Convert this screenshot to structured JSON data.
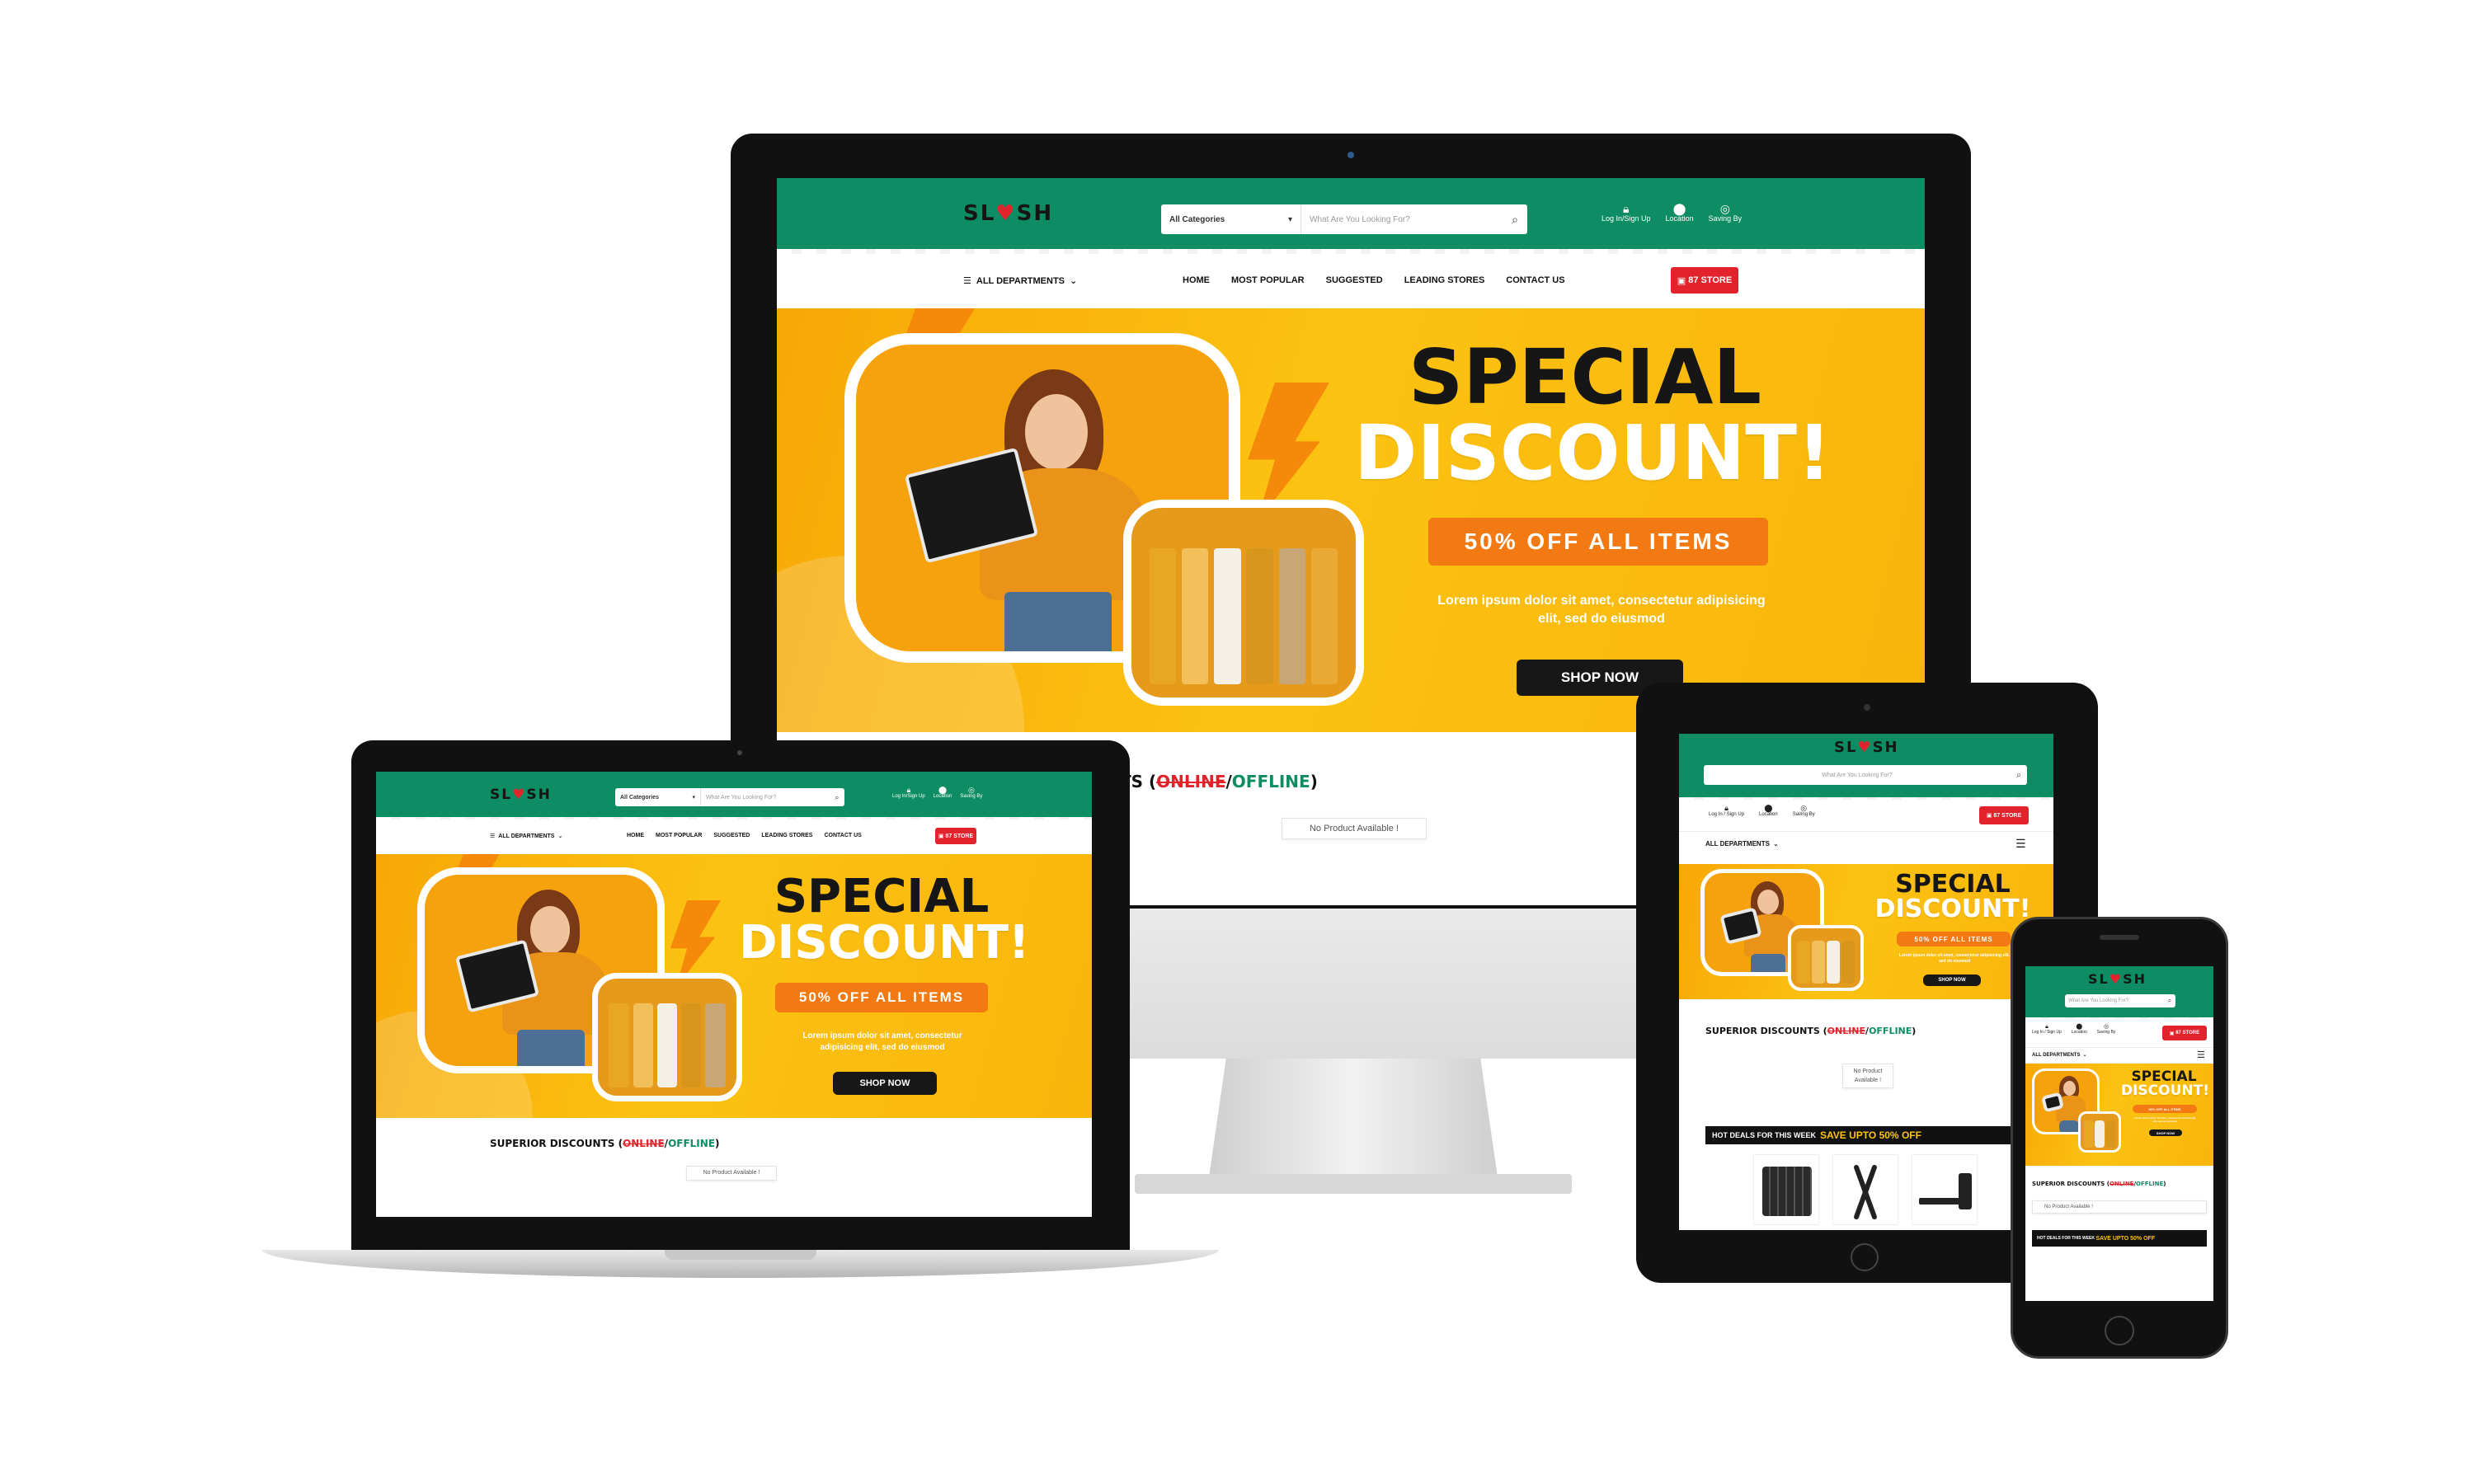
{
  "brand": {
    "logo_left": "SL",
    "logo_heart": "♥",
    "logo_right": "SH",
    "primary_color": "#0e8c63",
    "accent_red": "#e3232b",
    "hero_yellow": "#fcc212",
    "offer_orange": "#f37a12"
  },
  "header": {
    "categories_label": "All Categories",
    "search_placeholder": "What Are You Looking For?",
    "login_label": "Log In/Sign Up",
    "location_label": "Location",
    "saving_label": "Saving By",
    "login_label_split": "Log In / Sign Up"
  },
  "nav": {
    "departments": "ALL DEPARTMENTS",
    "links": [
      "HOME",
      "MOST POPULAR",
      "SUGGESTED",
      "LEADING STORES",
      "CONTACT US"
    ],
    "store_button": "87 STORE"
  },
  "hero": {
    "title_line1": "SPECIAL",
    "title_line2": "DISCOUNT!",
    "offer": "50% OFF ALL ITEMS",
    "lorem": "Lorem ipsum dolor sit amet, consectetur adipisicing elit, sed do eiusmod",
    "cta": "SHOP NOW"
  },
  "section": {
    "title_prefix": "SUPERIOR DISCOUNTS (",
    "online": "ONLINE",
    "slash": "/",
    "offline": "OFFLINE",
    "title_suffix": ")",
    "partial_prefix": "TS (",
    "no_product": "No Product Available !"
  },
  "deals": {
    "label": "HOT DEALS FOR THIS WEEK",
    "highlight": "SAVE UPTO 50% OFF"
  },
  "icons": [
    "lock-icon",
    "location-pin-icon",
    "cart-icon",
    "hamburger-icon",
    "chevron-down-icon",
    "search-icon",
    "store-icon"
  ]
}
